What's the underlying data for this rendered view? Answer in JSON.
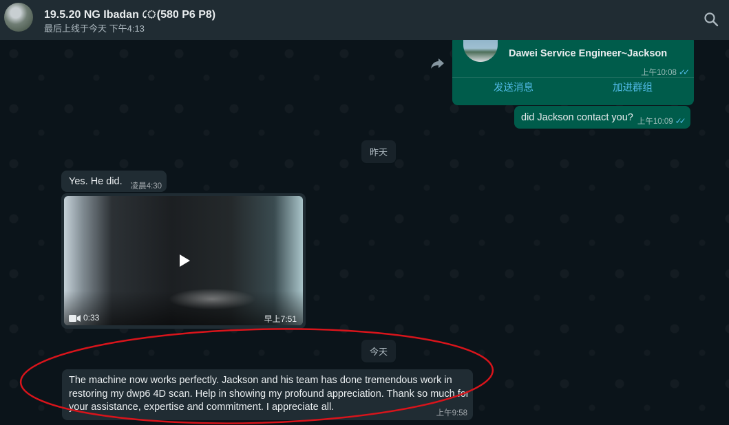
{
  "header": {
    "title": "19.5.20 NG Ibadan                      ে(580 P6 P8)",
    "status": "最后上线于今天 下午4:13",
    "search_icon": "search-icon"
  },
  "messages": {
    "contact_card": {
      "name": "Dawei Service Engineer~Jackson",
      "time": "上午10:08",
      "send_message": "发送消息",
      "join_group": "加进群组"
    },
    "out2": {
      "text": "did Jackson contact you?",
      "time": "上午10:09"
    },
    "separator_yesterday": "昨天",
    "in1": {
      "text": "Yes. He did.",
      "time": "凌晨4:30"
    },
    "video": {
      "duration": "0:33",
      "time": "早上7:51"
    },
    "separator_today": "今天",
    "in2": {
      "text": "The machine now works perfectly.  Jackson and his team has done tremendous work in restoring my dwp6 4D scan. Help in showing my profound appreciation. Thank so much for your assistance, expertise and commitment. I appreciate all.",
      "time": "上午9:58"
    }
  },
  "colors": {
    "background": "#0b141a",
    "header": "#202c33",
    "outgoing_bubble": "#005c4b",
    "incoming_bubble": "#202c33",
    "read_ticks": "#53bdeb",
    "annotation_circle": "#d9141b"
  }
}
